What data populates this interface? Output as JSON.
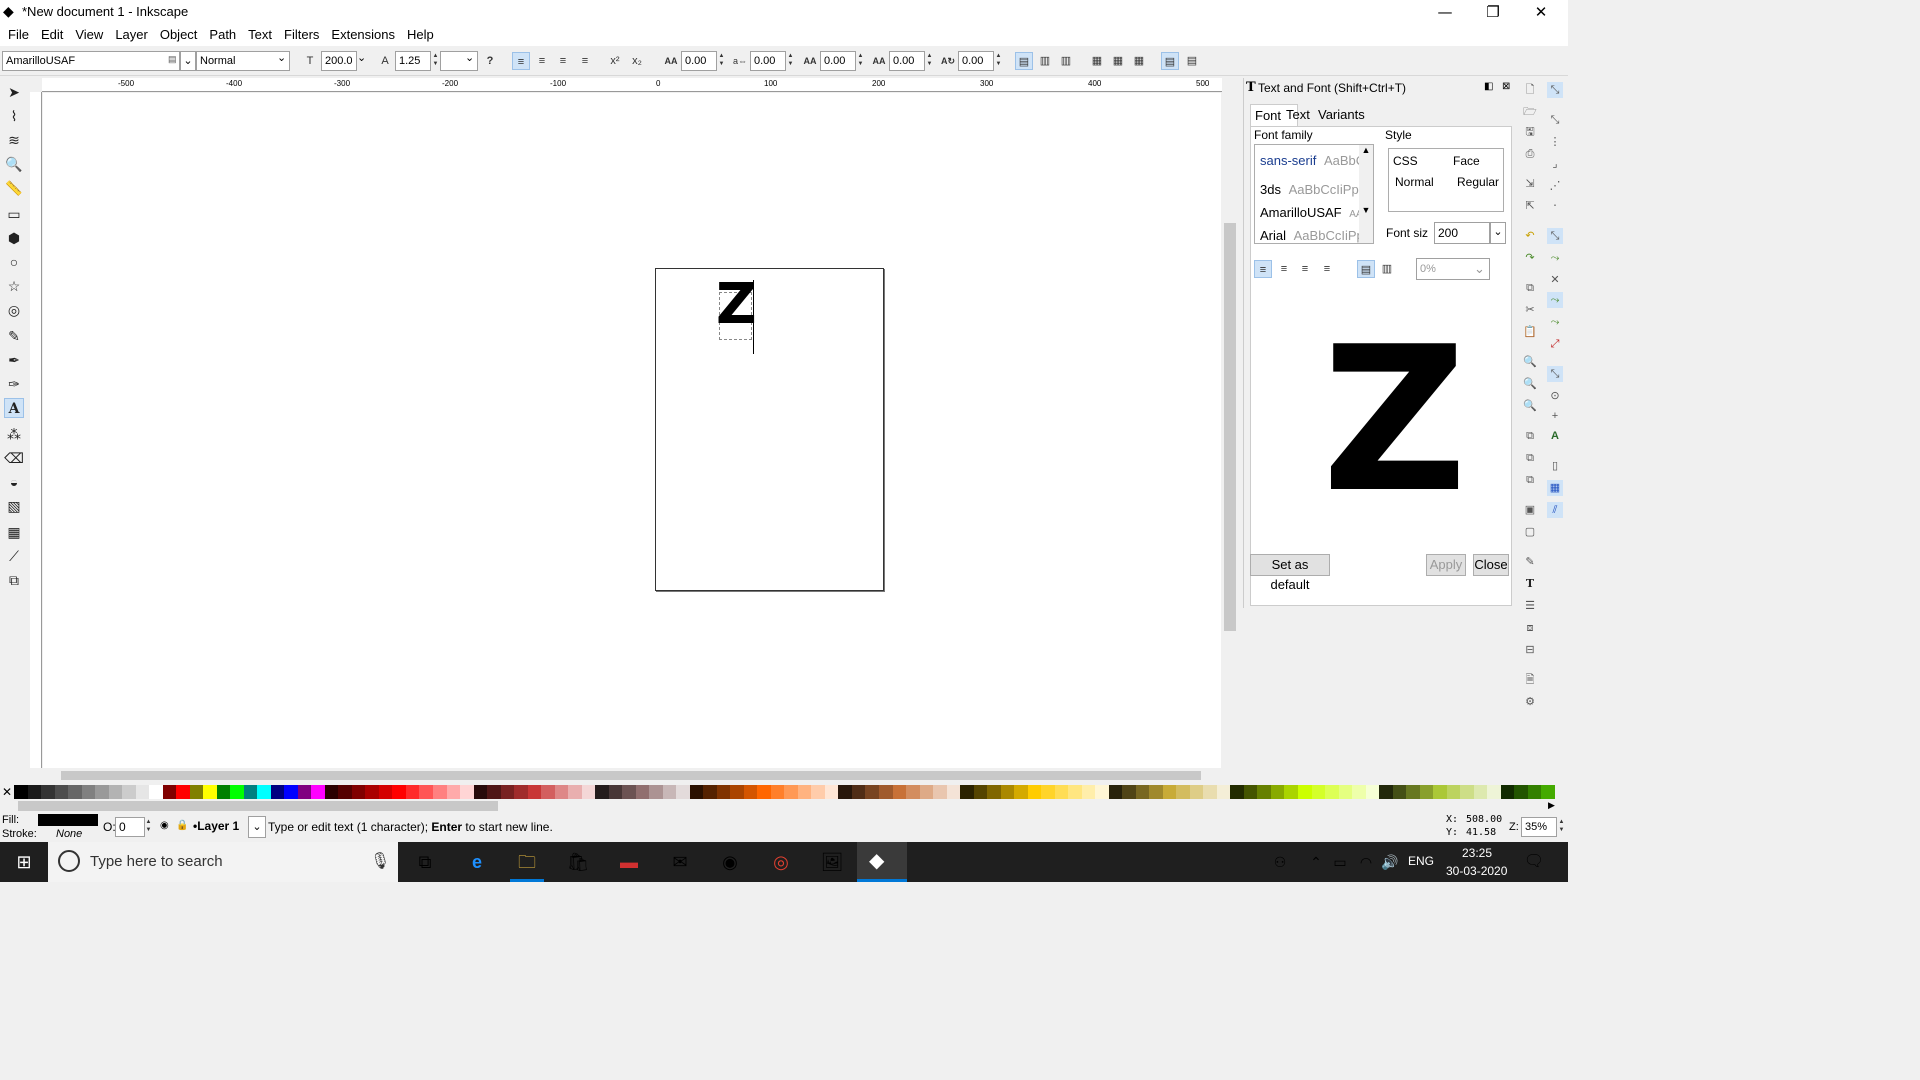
{
  "window": {
    "title": "*New document 1 - Inkscape",
    "minimize": "—",
    "maximize": "❐",
    "close": "✕"
  },
  "menu": [
    "File",
    "Edit",
    "View",
    "Layer",
    "Object",
    "Path",
    "Text",
    "Filters",
    "Extensions",
    "Help"
  ],
  "text_toolbar": {
    "font_family": "AmarilloUSAF",
    "font_style": "Normal",
    "font_size": "200.0",
    "line_spacing": "1.25",
    "letter_spacing": "0.00",
    "word_spacing": "0.00",
    "kerning_h": "0.00",
    "kerning_v": "0.00",
    "rotation": "0.00",
    "help": "?"
  },
  "ruler": {
    "labels": [
      "-500",
      "-400",
      "-300",
      "-200",
      "-100",
      "0",
      "100",
      "200",
      "300",
      "400",
      "500"
    ]
  },
  "canvas": {
    "text": "Z"
  },
  "panel": {
    "title": "Text and Font (Shift+Ctrl+T)",
    "tabs": [
      "Font",
      "Text",
      "Variants"
    ],
    "font_family_label": "Font family",
    "fonts": [
      {
        "name": "sans-serif",
        "sample": "AaBbCc"
      },
      {
        "name": "3ds",
        "sample": "AaBbCcIiPpQ"
      },
      {
        "name": "AmarilloUSAF",
        "sample": "AA"
      },
      {
        "name": "Arial",
        "sample": "AaBbCcIiPp"
      }
    ],
    "style_label": "Style",
    "style_header": {
      "css": "CSS",
      "face": "Face"
    },
    "style_row": {
      "css": "Normal",
      "face": "Regular"
    },
    "font_size_label": "Font siz",
    "font_size_value": "200",
    "line_spacing": "0%",
    "preview": "Z",
    "set_default": "Set as default",
    "apply": "Apply",
    "close": "Close"
  },
  "status": {
    "fill_label": "Fill:",
    "stroke_label": "Stroke:",
    "stroke_value": "None",
    "opacity_label": "O:",
    "opacity_value": "0",
    "layer": "•Layer 1",
    "message_pre": "Type or edit text (1 character); ",
    "message_bold": "Enter",
    "message_post": " to start new line.",
    "x_label": "X:",
    "x_value": "508.00",
    "y_label": "Y:",
    "y_value": "41.58",
    "zoom_label": "Z:",
    "zoom_value": "35%"
  },
  "taskbar": {
    "search_placeholder": "Type here to search",
    "lang": "ENG",
    "time": "23:25",
    "date": "30-03-2020"
  },
  "colors": {
    "accent": "#0078d7",
    "taskbar": "#1f1f1f"
  }
}
